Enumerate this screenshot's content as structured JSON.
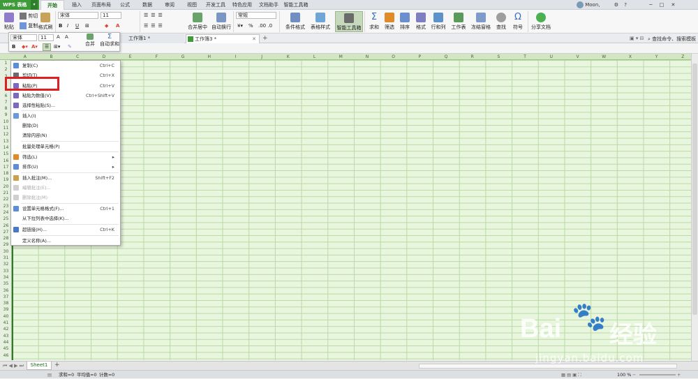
{
  "app": {
    "logo": "WPS 表格",
    "dropdown": "▾"
  },
  "menu_tabs": [
    "开始",
    "插入",
    "页面布局",
    "公式",
    "数据",
    "审阅",
    "视图",
    "开发工具",
    "特色应用",
    "文档助手",
    "智能工具箱"
  ],
  "user": {
    "name": "Moon,",
    "min": "─",
    "max": "□",
    "close": "✕"
  },
  "ribbon": {
    "paste": "粘贴",
    "cut": "剪切",
    "copy": "复制",
    "format_painter": "格式刷",
    "font": "宋体",
    "size": "11",
    "bold": "B",
    "italic": "I",
    "underline": "U",
    "merge": "合并居中",
    "wrap": "自动换行",
    "numfmt": "常规",
    "percent": "%",
    "cond": "条件格式",
    "table_style": "表格样式",
    "smart": "智能工具箱",
    "sum": "求和",
    "filter": "筛选",
    "sort": "排序",
    "format": "格式",
    "rowcol": "行和列",
    "sheet": "工作表",
    "freeze": "冻结窗格",
    "find": "查找",
    "symbol": "符号",
    "share": "分享文档"
  },
  "file_tabs": [
    "工作簿1 *",
    "工作簿3 *"
  ],
  "plus": "+",
  "search_hint": "查找命令、搜索模板",
  "mini": {
    "font": "宋体",
    "size": "11",
    "a_up": "A",
    "a_down": "A",
    "bold": "B",
    "merge": "合并",
    "autosum": "自动求和"
  },
  "columns": [
    "A",
    "B",
    "C",
    "D",
    "E",
    "F",
    "G",
    "H",
    "I",
    "J",
    "K",
    "L",
    "M",
    "N",
    "O",
    "P",
    "Q",
    "R",
    "S",
    "T",
    "U",
    "V",
    "W",
    "X",
    "Y",
    "Z"
  ],
  "rows": [
    "1",
    "2",
    "3",
    "4",
    "5",
    "6",
    "7",
    "8",
    "9",
    "10",
    "11",
    "12",
    "13",
    "14",
    "15",
    "16",
    "17",
    "18",
    "19",
    "20",
    "21",
    "22",
    "23",
    "24",
    "25",
    "26",
    "27",
    "28",
    "29",
    "30",
    "31",
    "32",
    "33",
    "34",
    "35",
    "36",
    "37",
    "38",
    "39",
    "40",
    "41",
    "42",
    "43",
    "44",
    "45",
    "46"
  ],
  "context_menu": [
    {
      "label": "复制(C)",
      "shortcut": "Ctrl+C",
      "color": "#5b8ed6"
    },
    {
      "label": "剪切(T)",
      "shortcut": "Ctrl+X",
      "color": "#6b6b6b"
    },
    {
      "label": "粘贴(P)",
      "shortcut": "Ctrl+V",
      "color": "#7c68c0"
    },
    {
      "label": "粘贴为数值(V)",
      "shortcut": "Ctrl+Shift+V",
      "color": "#7c68c0"
    },
    {
      "label": "选择性粘贴(S)...",
      "shortcut": "",
      "color": "#7c68c0"
    },
    {
      "label": "插入(I)",
      "shortcut": "",
      "color": "#6a9ad8"
    },
    {
      "label": "删除(D)",
      "shortcut": "",
      "color": ""
    },
    {
      "label": "清除内容(N)",
      "shortcut": "",
      "color": ""
    },
    {
      "label": "批量处理单元格(P)",
      "shortcut": "",
      "color": ""
    },
    {
      "label": "筛选(L)",
      "shortcut": "▸",
      "color": "#e08a2a"
    },
    {
      "label": "排序(U)",
      "shortcut": "▸",
      "color": "#5b8ed6"
    },
    {
      "label": "插入批注(M)...",
      "shortcut": "Shift+F2",
      "color": "#c9a24a"
    },
    {
      "label": "编辑批注(E)...",
      "shortcut": "",
      "color": "#cfcfcf"
    },
    {
      "label": "删除批注(M)",
      "shortcut": "",
      "color": "#cfcfcf"
    },
    {
      "label": "设置单元格格式(F)...",
      "shortcut": "Ctrl+1",
      "color": "#5b8ed6"
    },
    {
      "label": "从下拉列表中选择(K)...",
      "shortcut": "",
      "color": ""
    },
    {
      "label": "超链接(H)...",
      "shortcut": "Ctrl+K",
      "color": "#4a78c8"
    },
    {
      "label": "定义名称(A)...",
      "shortcut": "",
      "color": ""
    }
  ],
  "sheet_tab": "Sheet1",
  "status": {
    "sum": "求和=0",
    "avg": "平均值=0",
    "count": "计数=0",
    "zoom": "100 %"
  },
  "watermark": {
    "brand": "Bai",
    "brand2": "经验",
    "url": "jingyan.baidu.com"
  }
}
